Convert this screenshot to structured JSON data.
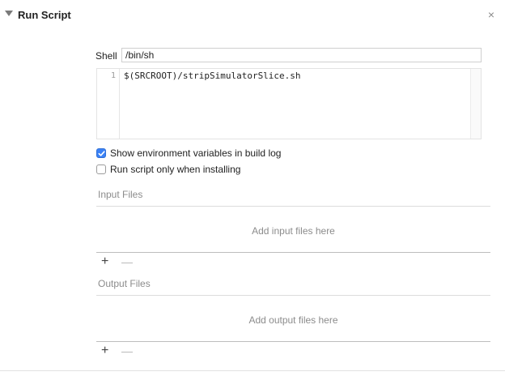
{
  "phase": {
    "title": "Run Script",
    "close_glyph": "×"
  },
  "shell": {
    "label": "Shell",
    "value": "/bin/sh"
  },
  "script": {
    "line_number": "1",
    "code": "$(SRCROOT)/stripSimulatorSlice.sh"
  },
  "options": {
    "show_env_label": "Show environment variables in build log",
    "show_env_checked": true,
    "install_only_label": "Run script only when installing",
    "install_only_checked": false
  },
  "input_files": {
    "label": "Input Files",
    "placeholder": "Add input files here",
    "add_glyph": "+",
    "remove_glyph": "—"
  },
  "output_files": {
    "label": "Output Files",
    "placeholder": "Add output files here",
    "add_glyph": "+",
    "remove_glyph": "—"
  },
  "colors": {
    "checkbox_accent": "#3b82f6",
    "placeholder_text": "#8c8c8c"
  }
}
